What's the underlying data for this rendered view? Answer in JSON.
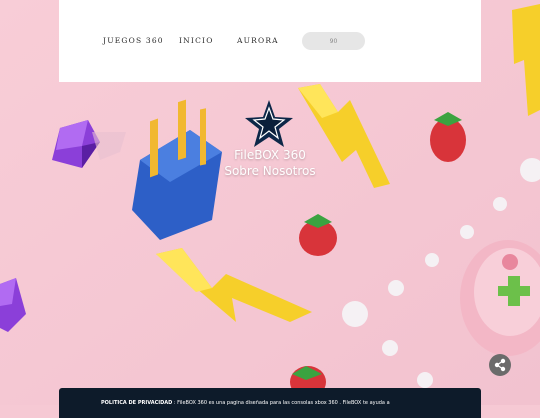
{
  "nav": {
    "items": [
      {
        "label": "JUEGOS 360"
      },
      {
        "label": "INICIO"
      },
      {
        "label": "AURORA"
      }
    ],
    "search_value": "90"
  },
  "hero": {
    "title": "FileBOX 360",
    "subtitle": "Sobre Nosotros",
    "logo_icon": "star-logo-icon"
  },
  "footer": {
    "bold_label": "POLÍTICA DE PRIVACIDAD",
    "text": " : FileBOX 360 es una pagina diseñada para las consolas xbox 360 . FileBOX te ayuda a"
  },
  "share": {
    "icon": "share-icon"
  },
  "colors": {
    "background": "#f6c9d4",
    "footer": "#0d1b2a",
    "lightning": "#f6cf2a",
    "strawberry": "#d8343a",
    "gem": "#8b3fd9",
    "chest": "#2d5fc7"
  }
}
